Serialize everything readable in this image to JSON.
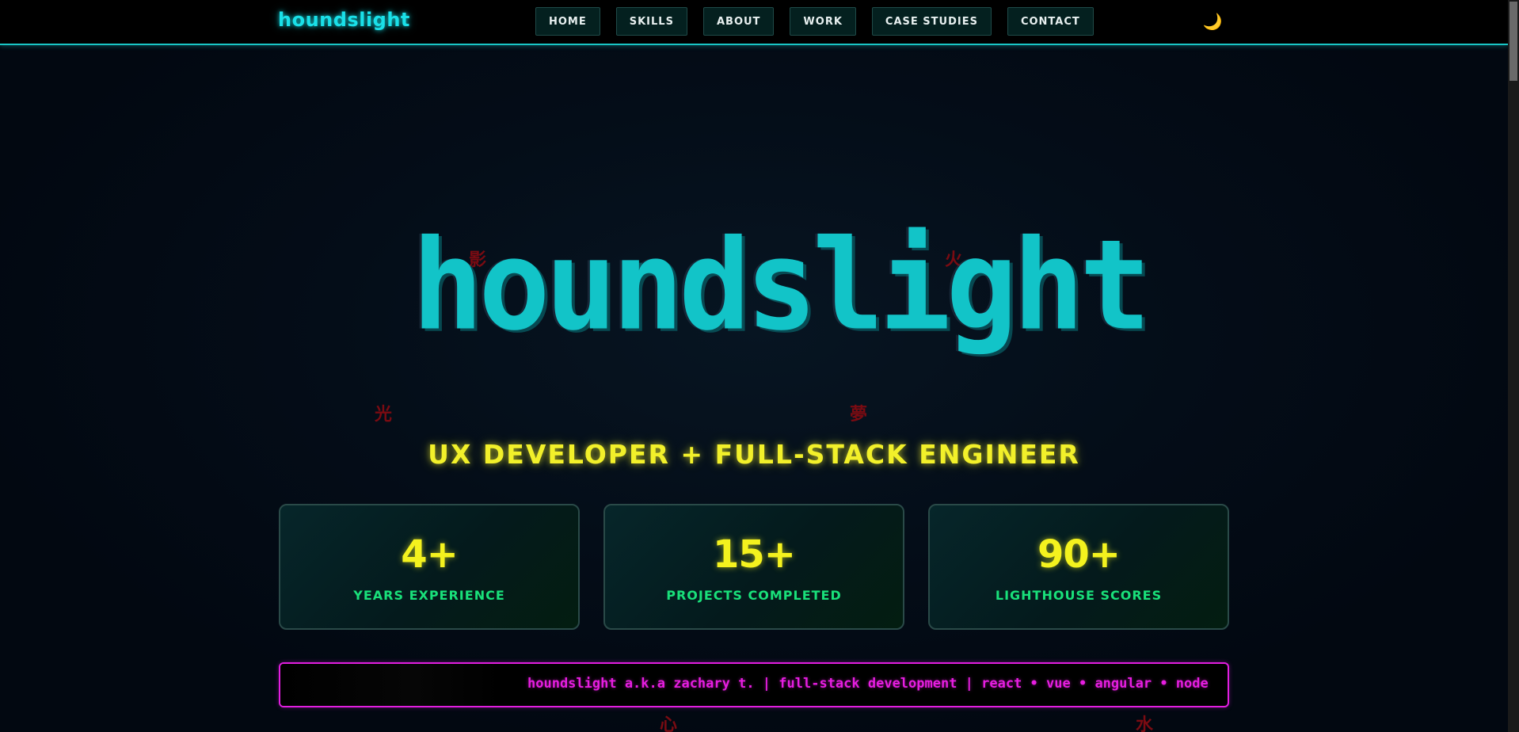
{
  "header": {
    "logo": "houndslight",
    "nav": [
      {
        "label": "HOME"
      },
      {
        "label": "SKILLS"
      },
      {
        "label": "ABOUT"
      },
      {
        "label": "WORK"
      },
      {
        "label": "CASE STUDIES"
      },
      {
        "label": "CONTACT"
      }
    ],
    "theme_toggle_icon": "🌙"
  },
  "hero": {
    "title": "houndslight",
    "subtitle": "UX DEVELOPER + FULL-STACK ENGINEER",
    "kanji": [
      "影",
      "火",
      "光",
      "夢",
      "心",
      "水"
    ]
  },
  "stats": [
    {
      "value": "4+",
      "label": "YEARS EXPERIENCE"
    },
    {
      "value": "15+",
      "label": "PROJECTS COMPLETED"
    },
    {
      "value": "90+",
      "label": "LIGHTHOUSE SCORES"
    }
  ],
  "marquee": {
    "text": "houndslight a.k.a zachary t. | full-stack development | react • vue • angular • node"
  },
  "colors": {
    "accent_cyan": "#12c4c8",
    "accent_yellow": "#f2f02a",
    "accent_green": "#19e07a",
    "accent_magenta": "#e21ee0",
    "kanji_red": "#7a0b12",
    "background": "#020811"
  }
}
